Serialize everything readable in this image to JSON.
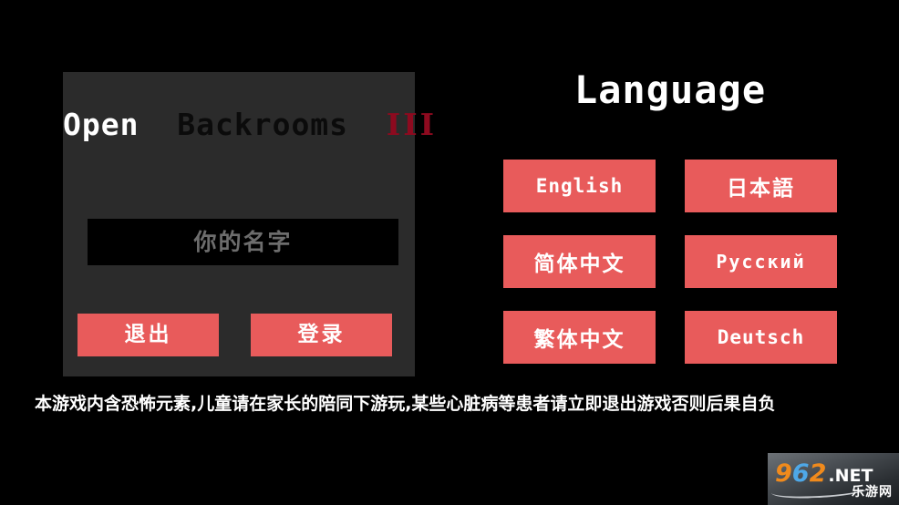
{
  "background_color": "#000000",
  "login_panel": {
    "panel_color": "#2b2b2b",
    "title": {
      "word1": "Open",
      "word1_color": "#ffffff",
      "word2": "Backrooms",
      "word2_color": "#0b0b0b",
      "word3": "III",
      "word3_color": "#8d0a1f"
    },
    "name_input": {
      "value": "",
      "placeholder": "你的名字"
    },
    "exit_label": "退出",
    "login_label": "登录",
    "button_color": "#e85b5b"
  },
  "language_panel": {
    "heading": "Language",
    "button_color": "#e85b5b",
    "options": [
      {
        "label": "English",
        "style": "latin"
      },
      {
        "label": "日本語",
        "style": "cjk"
      },
      {
        "label": "简体中文",
        "style": "cjk"
      },
      {
        "label": "Русский",
        "style": "cyrillic"
      },
      {
        "label": "繁体中文",
        "style": "cjk"
      },
      {
        "label": "Deutsch",
        "style": "latin"
      }
    ]
  },
  "warning": {
    "text": "本游戏内含恐怖元素,儿童请在家长的陪同下游玩,某些心脏病等患者请立即退出游戏否则后果自负"
  },
  "watermark": {
    "digit1": "9",
    "digit2": "6",
    "digit3": "2",
    "suffix": ".NET",
    "chinese": "乐游网",
    "digit1_color": "#f08a1c",
    "digit2_color": "#4ea8e8",
    "digit3_color": "#f08a1c"
  }
}
